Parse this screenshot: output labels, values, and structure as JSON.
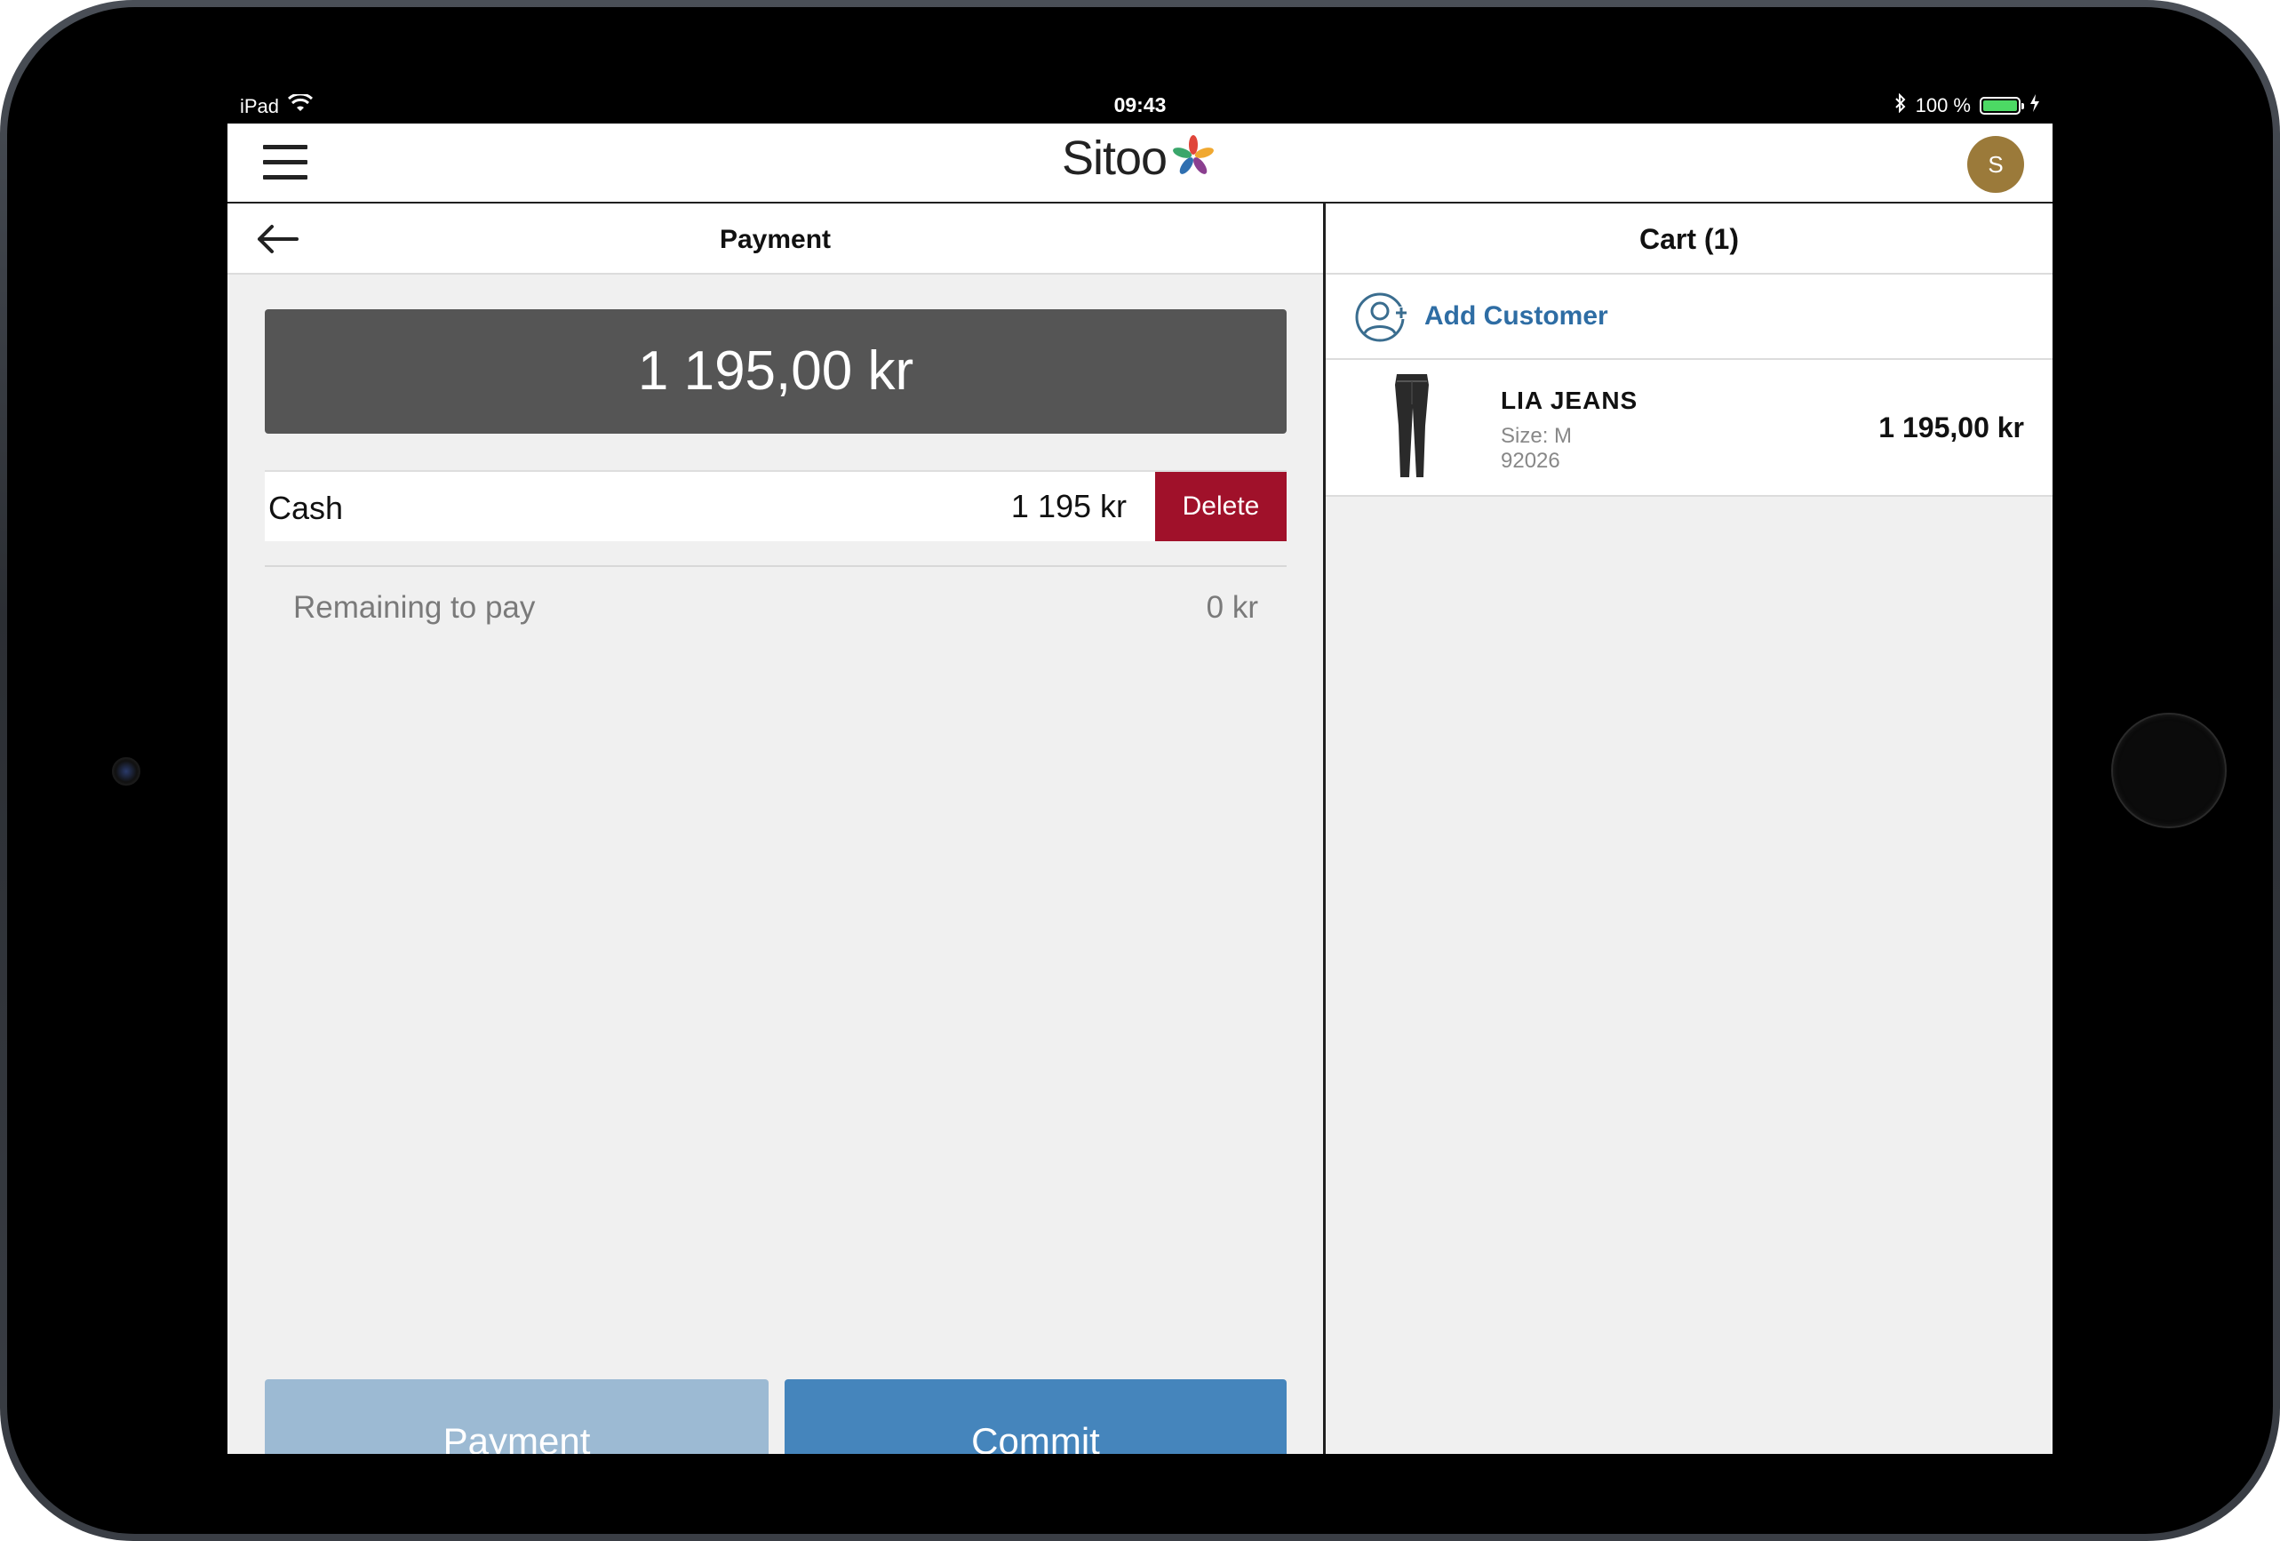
{
  "status_bar": {
    "device": "iPad",
    "time": "09:43",
    "battery": "100 %"
  },
  "app_bar": {
    "logo": "Sitoo",
    "avatar_initial": "S"
  },
  "payment": {
    "title": "Payment",
    "total": "1 195,00 kr",
    "cash_label": "Cash",
    "cash_amount": "1 195 kr",
    "delete_label": "Delete",
    "remaining_label": "Remaining to pay",
    "remaining_amount": "0 kr",
    "payment_button": "Payment",
    "commit_button": "Commit"
  },
  "cart": {
    "title": "Cart (1)",
    "add_customer": "Add Customer",
    "items": [
      {
        "name": "LIA JEANS",
        "size": "Size: M",
        "sku": "92026",
        "price": "1 195,00 kr"
      }
    ]
  },
  "colors": {
    "accent_blue": "#4585bc",
    "disabled_blue": "#9cbad3",
    "delete_red": "#a0112a",
    "total_bg": "#555555",
    "avatar": "#9b7a3a"
  }
}
